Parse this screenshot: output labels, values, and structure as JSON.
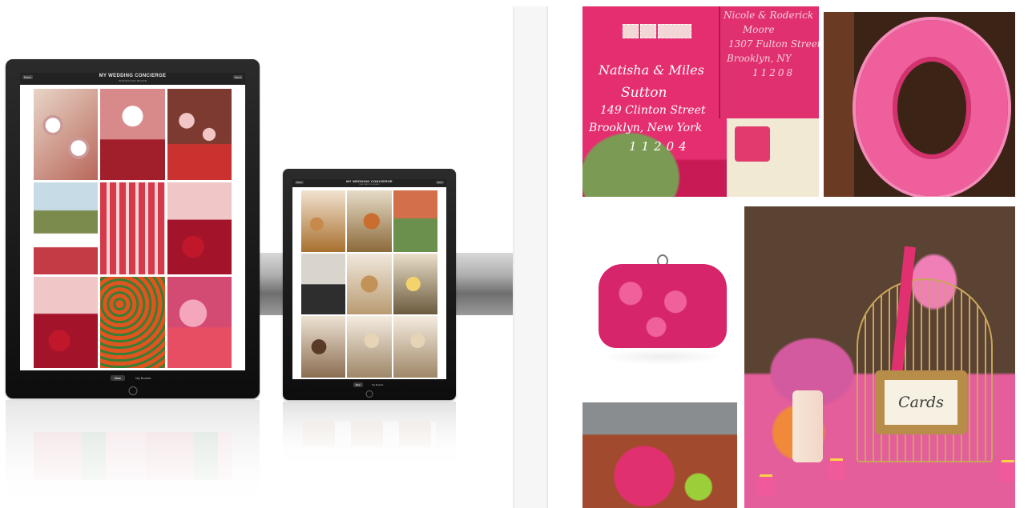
{
  "left_panel": {
    "large_tablet": {
      "nav_title": "MY WEDDING CONCIERGE",
      "nav_subtitle": "INSPIRATION BOARD",
      "nav_left": "Back",
      "nav_right": "Next",
      "toolbar": [
        "Main",
        "My Boards"
      ],
      "thumbnails": [
        "donuts",
        "cake",
        "cupcakes",
        "garden",
        "shots",
        "berries",
        "strawberry",
        "roses",
        "roses"
      ]
    },
    "small_tablet": {
      "nav_title": "MY WEDDING CONCIERGE",
      "nav_subtitle": "INSPIRATION BOARD",
      "nav_left": "Back",
      "nav_right": "Next",
      "toolbar": [
        "Main",
        "My Boards"
      ],
      "thumbnails": [
        "pastry",
        "cookies",
        "booth",
        "coffee",
        "tarts",
        "donut",
        "chocolates",
        "mini",
        "mini"
      ]
    }
  },
  "right_panel": {
    "envelope": {
      "address_lines": [
        "Natisha & Miles",
        "Sutton",
        "149 Clinton Street",
        "Brooklyn, New York",
        "11204"
      ],
      "card_lines": [
        "Nicole & Roderick",
        "Moore",
        "1307 Fulton Street",
        "Brooklyn, NY",
        "11208"
      ]
    },
    "birdcage_card": "Cards"
  },
  "colors": {
    "accent_pink": "#e0306f",
    "device_black": "#111111"
  }
}
